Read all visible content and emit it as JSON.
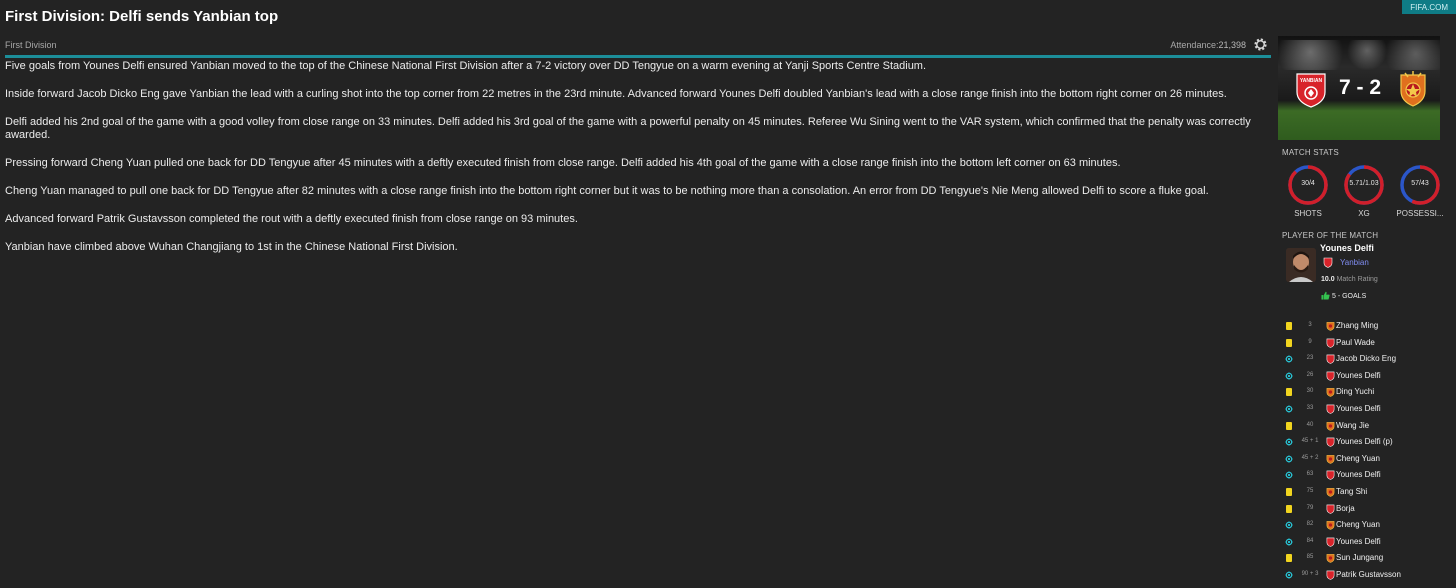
{
  "header": {
    "title": "First Division: Delfi sends Yanbian top",
    "badge": "FIFA.COM"
  },
  "meta": {
    "competition": "First Division",
    "attendance_label": "Attendance:",
    "attendance_value": "21,398"
  },
  "article": {
    "paragraphs": [
      "Five goals from Younes Delfi ensured Yanbian moved to the top of the Chinese National First Division after a 7-2 victory over DD Tengyue on a warm evening at Yanji Sports Centre Stadium.",
      "Inside forward Jacob Dicko Eng gave Yanbian the lead with a curling shot into the top corner from 22 metres in the 23rd minute. Advanced forward Younes Delfi doubled Yanbian's lead with a close range finish into the bottom right corner on 26 minutes.",
      "Delfi added his 2nd goal of the game with a good volley from close range on 33 minutes. Delfi added his 3rd goal of the game with a powerful penalty on 45 minutes. Referee Wu Sining went to the VAR system, which confirmed that the penalty was correctly awarded.",
      "Pressing forward Cheng Yuan pulled one back for DD Tengyue after 45 minutes with a deftly executed finish from close range. Delfi added his 4th goal of the game with a close range finish into the bottom left corner on 63 minutes.",
      "Cheng Yuan managed to pull one back for DD Tengyue after 82 minutes with a close range finish into the bottom right corner but it was to be nothing more than a consolation. An error from DD Tengyue's Nie Meng allowed Delfi to score a fluke goal.",
      "Advanced forward Patrik Gustavsson completed the rout with a deftly executed finish from close range on 93 minutes.",
      "Yanbian have climbed above Wuhan Changjiang to 1st in the Chinese National First Division."
    ]
  },
  "scoreboard": {
    "score": "7 - 2",
    "home_crest_text": "YANBIAN",
    "home_color": "#d8232a",
    "away_color": "#e0701e"
  },
  "match_stats": {
    "label": "MATCH STATS",
    "stats": [
      {
        "label": "SHOTS",
        "value": "30/4",
        "home_share": 0.88
      },
      {
        "label": "XG",
        "value": "5.71/1.03",
        "home_share": 0.85
      },
      {
        "label": "POSSESSI...",
        "value": "57/43",
        "home_share": 0.57
      }
    ],
    "home_color": "#d11f2a",
    "away_color": "#2b56c9"
  },
  "player_of_match": {
    "label": "PLAYER OF THE MATCH",
    "name": "Younes Delfi",
    "club": "Yanbian",
    "rating": "10.0",
    "rating_label": "Match Rating",
    "goals": "5 - GOALS"
  },
  "events": [
    {
      "type": "yellow-card",
      "minute": "3",
      "team": "away",
      "player": "Zhang Ming"
    },
    {
      "type": "yellow-card",
      "minute": "9",
      "team": "home",
      "player": "Paul Wade"
    },
    {
      "type": "goal",
      "minute": "23",
      "team": "home",
      "player": "Jacob Dicko Eng"
    },
    {
      "type": "goal",
      "minute": "26",
      "team": "home",
      "player": "Younes Delfi"
    },
    {
      "type": "yellow-card",
      "minute": "30",
      "team": "away",
      "player": "Ding Yuchi"
    },
    {
      "type": "goal",
      "minute": "33",
      "team": "home",
      "player": "Younes Delfi"
    },
    {
      "type": "yellow-card",
      "minute": "40",
      "team": "away",
      "player": "Wang Jie"
    },
    {
      "type": "goal",
      "minute": "45 + 1",
      "team": "home",
      "player": "Younes Delfi (p)"
    },
    {
      "type": "goal",
      "minute": "45 + 2",
      "team": "away",
      "player": "Cheng Yuan"
    },
    {
      "type": "goal",
      "minute": "63",
      "team": "home",
      "player": "Younes Delfi"
    },
    {
      "type": "yellow-card",
      "minute": "75",
      "team": "away",
      "player": "Tang Shi"
    },
    {
      "type": "yellow-card",
      "minute": "79",
      "team": "home",
      "player": "Borja"
    },
    {
      "type": "goal",
      "minute": "82",
      "team": "away",
      "player": "Cheng Yuan"
    },
    {
      "type": "goal",
      "minute": "84",
      "team": "home",
      "player": "Younes Delfi"
    },
    {
      "type": "yellow-card",
      "minute": "85",
      "team": "away",
      "player": "Sun Jungang"
    },
    {
      "type": "goal",
      "minute": "90 + 3",
      "team": "home",
      "player": "Patrik Gustavsson"
    }
  ]
}
